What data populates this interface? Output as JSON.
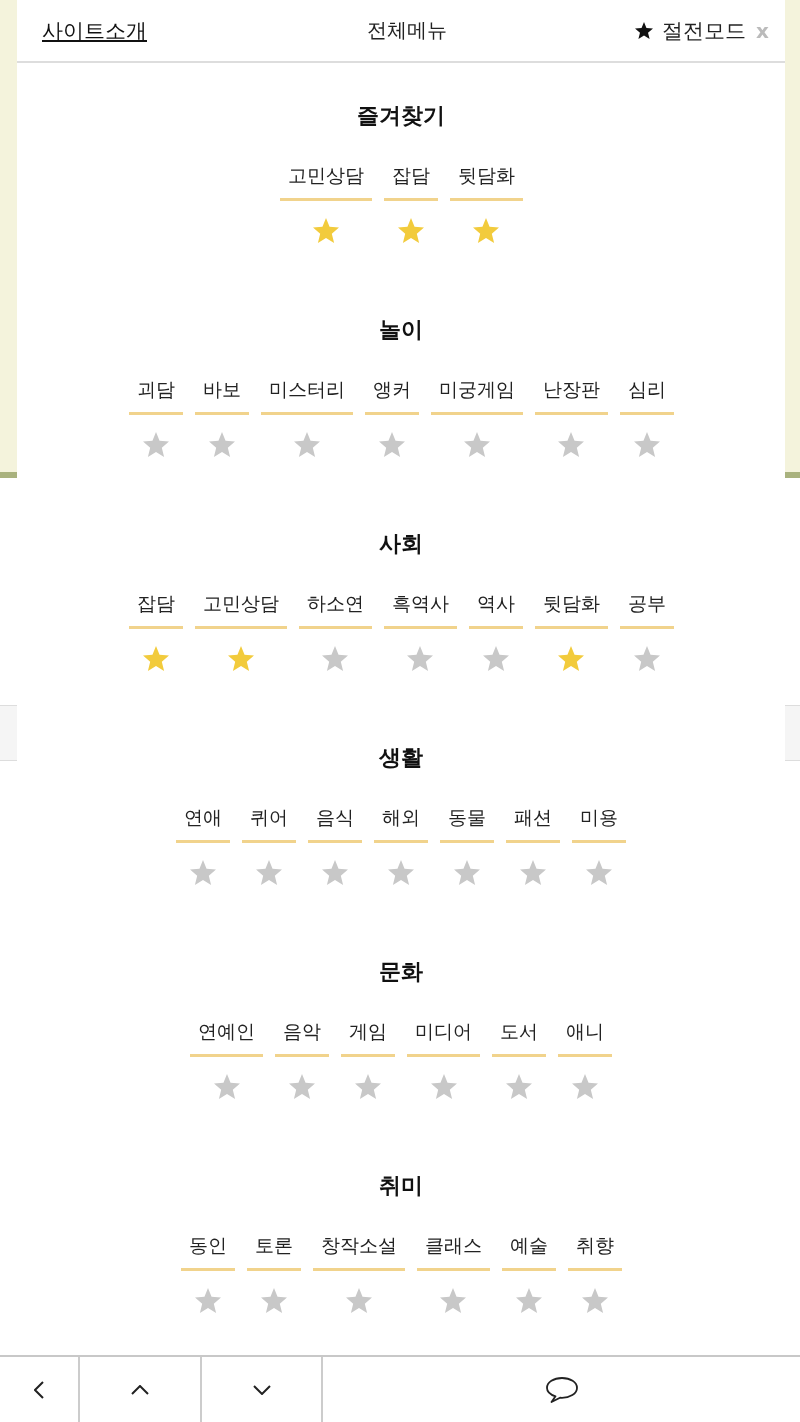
{
  "header": {
    "about_link": "사이트소개",
    "title": "전체메뉴",
    "power_save": "절전모드",
    "close": "x"
  },
  "sections": [
    {
      "title": "즐겨찾기",
      "items": [
        {
          "label": "고민상담",
          "starred": true
        },
        {
          "label": "잡담",
          "starred": true
        },
        {
          "label": "뒷담화",
          "starred": true
        }
      ]
    },
    {
      "title": "놀이",
      "items": [
        {
          "label": "괴담",
          "starred": false
        },
        {
          "label": "바보",
          "starred": false
        },
        {
          "label": "미스터리",
          "starred": false
        },
        {
          "label": "앵커",
          "starred": false
        },
        {
          "label": "미궁게임",
          "starred": false
        },
        {
          "label": "난장판",
          "starred": false
        },
        {
          "label": "심리",
          "starred": false
        }
      ]
    },
    {
      "title": "사회",
      "items": [
        {
          "label": "잡담",
          "starred": true
        },
        {
          "label": "고민상담",
          "starred": true
        },
        {
          "label": "하소연",
          "starred": false
        },
        {
          "label": "흑역사",
          "starred": false
        },
        {
          "label": "역사",
          "starred": false
        },
        {
          "label": "뒷담화",
          "starred": true
        },
        {
          "label": "공부",
          "starred": false
        }
      ]
    },
    {
      "title": "생활",
      "items": [
        {
          "label": "연애",
          "starred": false
        },
        {
          "label": "퀴어",
          "starred": false
        },
        {
          "label": "음식",
          "starred": false
        },
        {
          "label": "해외",
          "starred": false
        },
        {
          "label": "동물",
          "starred": false
        },
        {
          "label": "패션",
          "starred": false
        },
        {
          "label": "미용",
          "starred": false
        }
      ]
    },
    {
      "title": "문화",
      "items": [
        {
          "label": "연예인",
          "starred": false
        },
        {
          "label": "음악",
          "starred": false
        },
        {
          "label": "게임",
          "starred": false
        },
        {
          "label": "미디어",
          "starred": false
        },
        {
          "label": "도서",
          "starred": false
        },
        {
          "label": "애니",
          "starred": false
        }
      ]
    },
    {
      "title": "취미",
      "items": [
        {
          "label": "동인",
          "starred": false
        },
        {
          "label": "토론",
          "starred": false
        },
        {
          "label": "창작소설",
          "starred": false
        },
        {
          "label": "클래스",
          "starred": false
        },
        {
          "label": "예술",
          "starred": false
        },
        {
          "label": "취향",
          "starred": false
        }
      ]
    }
  ]
}
